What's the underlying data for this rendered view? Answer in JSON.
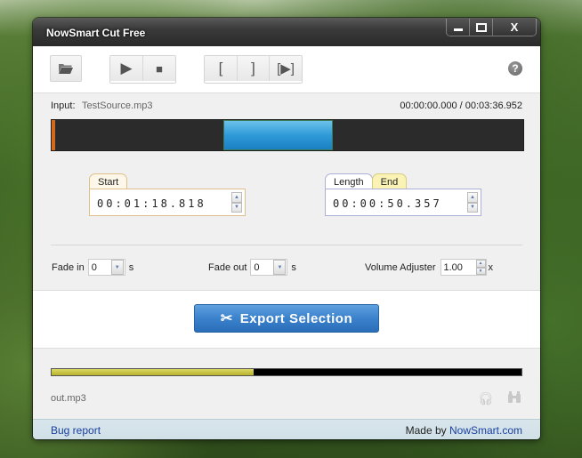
{
  "window": {
    "title": "NowSmart Cut Free",
    "controls": {
      "minimize": "minimize",
      "maximize": "maximize",
      "close": "X"
    }
  },
  "toolbar": {
    "open_icon": "folder-open-icon",
    "play_icon": "▶",
    "stop_icon": "■",
    "mark_start": "[",
    "mark_end": "]",
    "play_selection": "[▶]",
    "help": "?"
  },
  "input": {
    "label": "Input:",
    "filename": "TestSource.mp3",
    "current_time": "00:00:00.000",
    "separator": "/",
    "total_time": "00:03:36.952"
  },
  "timeline": {
    "duration_seconds": 216.952,
    "cursor_seconds": 0,
    "selection_start_seconds": 78.818,
    "selection_length_seconds": 50.357,
    "colors": {
      "selection": "#2f9ad8",
      "cursor": "#d2691e",
      "track": "#2b2b2b"
    }
  },
  "start": {
    "tab": "Start",
    "value": "00:01:18.818"
  },
  "length_end": {
    "tab_length": "Length",
    "tab_end": "End",
    "active_tab": "Length",
    "value": "00:00:50.357"
  },
  "options": {
    "fade_in": {
      "label": "Fade in",
      "value": "0",
      "unit": "s"
    },
    "fade_out": {
      "label": "Fade out",
      "value": "0",
      "unit": "s"
    },
    "volume": {
      "label": "Volume Adjuster",
      "value": "1.00",
      "unit": "x"
    }
  },
  "export": {
    "label": "Export Selection",
    "icon": "scissors-icon"
  },
  "output": {
    "progress": 0.43,
    "filename": "out.mp3",
    "listen_icon": "headphones-icon",
    "locate_icon": "binoculars-icon"
  },
  "footer": {
    "bug_report": "Bug report",
    "made_by": "Made by ",
    "site": "NowSmart.com"
  }
}
